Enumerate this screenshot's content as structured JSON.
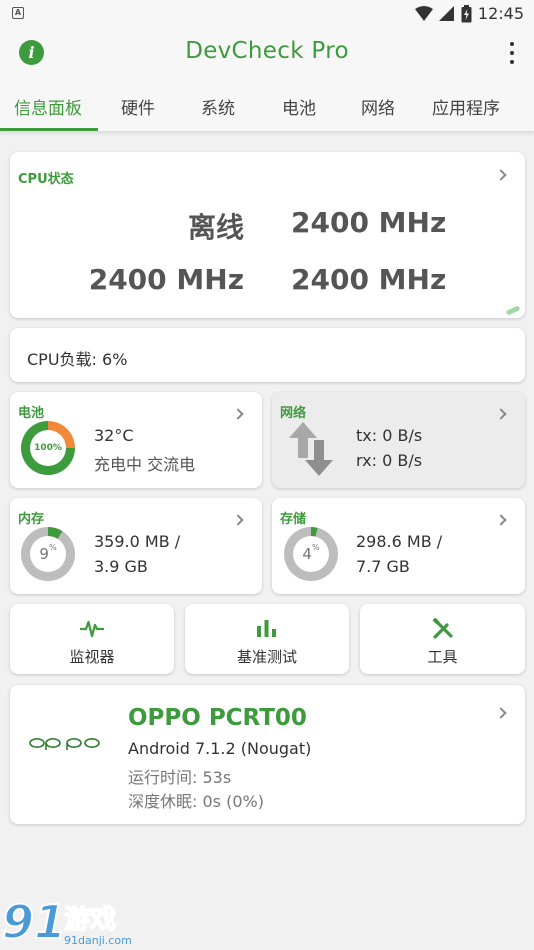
{
  "status_bar": {
    "time": "12:45",
    "notification_glyph": "A"
  },
  "app_bar": {
    "title": "DevCheck Pro",
    "info_icon": "info-icon",
    "menu_icon": "more-vert-icon"
  },
  "tabs": [
    {
      "label": "信息面板",
      "active": true
    },
    {
      "label": "硬件",
      "active": false
    },
    {
      "label": "系统",
      "active": false
    },
    {
      "label": "电池",
      "active": false
    },
    {
      "label": "网络",
      "active": false
    },
    {
      "label": "应用程序",
      "active": false
    }
  ],
  "cpu_status": {
    "label": "CPU状态",
    "cores": [
      "离线",
      "2400 MHz",
      "2400 MHz",
      "2400 MHz"
    ]
  },
  "cpu_load": {
    "text": "CPU负载: 6%"
  },
  "battery": {
    "label": "电池",
    "percent": 100,
    "percent_text": "100%",
    "temp": "32°C",
    "status": "充电中 交流电"
  },
  "network": {
    "label": "网络",
    "tx": "tx: 0 B/s",
    "rx": "rx: 0 B/s"
  },
  "memory": {
    "label": "内存",
    "percent": 9,
    "percent_text": "9",
    "percent_sign": "%",
    "line1": "359.0 MB /",
    "line2": "3.9 GB"
  },
  "storage": {
    "label": "存储",
    "percent": 4,
    "percent_text": "4",
    "percent_sign": "%",
    "line1": "298.6 MB /",
    "line2": "7.7 GB"
  },
  "tools": [
    {
      "label": "监视器",
      "icon": "pulse-icon"
    },
    {
      "label": "基准测试",
      "icon": "bar-chart-icon"
    },
    {
      "label": "工具",
      "icon": "tools-icon"
    }
  ],
  "device": {
    "brand_logo_text": "OPPO",
    "title": "OPPO PCRT00",
    "android": "Android 7.1.2 (Nougat)",
    "uptime": "运行时间: 53s",
    "deep_sleep": "深度休眠: 0s (0%)"
  },
  "watermark": {
    "logo": "91",
    "text": "游戏",
    "url": "91danji.com"
  },
  "colors": {
    "accent": "#3d9a3d",
    "ring_track": "#bdbdbd",
    "battery_ring_orange": "#ef8a3a"
  }
}
